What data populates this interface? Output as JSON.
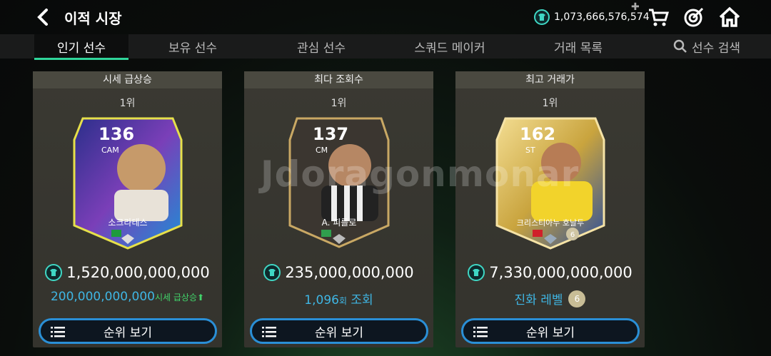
{
  "header": {
    "title": "이적 시장",
    "coins": "1,073,666,576,574"
  },
  "tabs": [
    {
      "label": "인기 선수"
    },
    {
      "label": "보유 선수"
    },
    {
      "label": "관심 선수"
    },
    {
      "label": "스쿼드 메이커"
    },
    {
      "label": "거래 목록"
    },
    {
      "label": "선수 검색"
    }
  ],
  "panels": [
    {
      "heading": "시세 급상승",
      "rank": "1위",
      "player": {
        "ovr": "136",
        "pos": "CAM",
        "name": "소크라테스"
      },
      "price": "1,520,000,000,000",
      "sub_value": "200,000,000,000",
      "sub_tag": "시세 급상승",
      "button": "순위 보기"
    },
    {
      "heading": "최다 조회수",
      "rank": "1위",
      "player": {
        "ovr": "137",
        "pos": "CM",
        "name": "A. 피를로"
      },
      "price": "235,000,000,000",
      "sub_value": "1,096",
      "sub_unit": "회",
      "sub_text": " 조회",
      "button": "순위 보기"
    },
    {
      "heading": "최고 거래가",
      "rank": "1위",
      "player": {
        "ovr": "162",
        "pos": "ST",
        "name": "크리스티아누 호날두",
        "level": "6"
      },
      "price": "7,330,000,000,000",
      "sub_text": "진화 레벨",
      "sub_badge": "6",
      "button": "순위 보기"
    }
  ],
  "watermark": "Jdoragonmonar",
  "colors": {
    "accent_green": "#2fd59a",
    "coin": "#3fd7c4",
    "button_border": "#2a8fd6",
    "sub_text": "#3fb6e4"
  }
}
